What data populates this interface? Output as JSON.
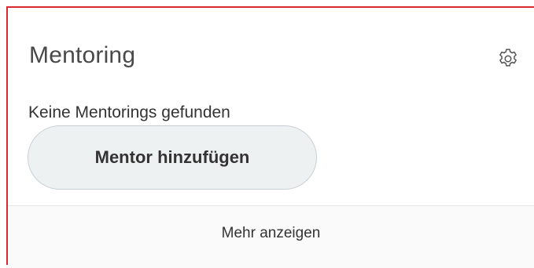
{
  "card": {
    "title": "Mentoring",
    "settings_icon": "gear-icon",
    "empty_message": "Keine Mentorings gefunden",
    "add_button_label": "Mentor hinzufügen",
    "more_link_label": "Mehr anzeigen"
  },
  "colors": {
    "accent_border": "#d9282e",
    "button_bg": "#eef1f2",
    "text": "#333333"
  }
}
